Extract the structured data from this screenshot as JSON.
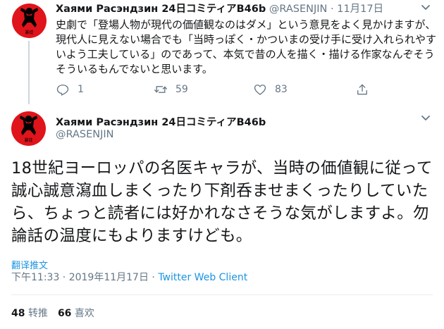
{
  "parent": {
    "author_name": "Хаями Расэндзин 24日コミティアB46b",
    "handle": "@RASENJIN",
    "dot": "·",
    "date": "11月17日",
    "avatar_badge": "暴徒",
    "text": "史劇で「登場人物が現代の価値観なのはダメ」という意見をよく見かけますが、現代人に見えない場合でも「当時っぽく・かついまの受け手に受け入れられやすいよう工夫している」のであって、本気で昔の人を描く・描ける作家なんぞそうそういるもんでないと思います。",
    "reply_count": "1",
    "retweet_count": "59",
    "like_count": "83"
  },
  "main": {
    "author_name": "Хаями Расэндзин 24日コミティアB46b",
    "handle": "@RASENJIN",
    "avatar_badge": "暴徒",
    "text": "18世紀ヨーロッパの名医キャラが、当時の価値観に従って誠心誠意瀉血しまくったり下剤呑ませまくったりしていたら、ちょっと読者には好かれなさそうな気がしますよ。勿論話の温度にもよりますけども。",
    "translate_label": "翻译推文",
    "time": "下午11:33 · 2019年11月17日 · ",
    "client": "Twitter Web Client",
    "retweets_count": "48",
    "retweets_label": "转推",
    "likes_count": "66",
    "likes_label": "喜欢"
  },
  "colors": {
    "accent": "#1b95e0",
    "muted": "#657786",
    "text": "#14171a",
    "avatar_bg": "#e0141b"
  },
  "icons": [
    "reply-icon",
    "retweet-icon",
    "like-icon",
    "share-icon",
    "caret-down-icon"
  ]
}
